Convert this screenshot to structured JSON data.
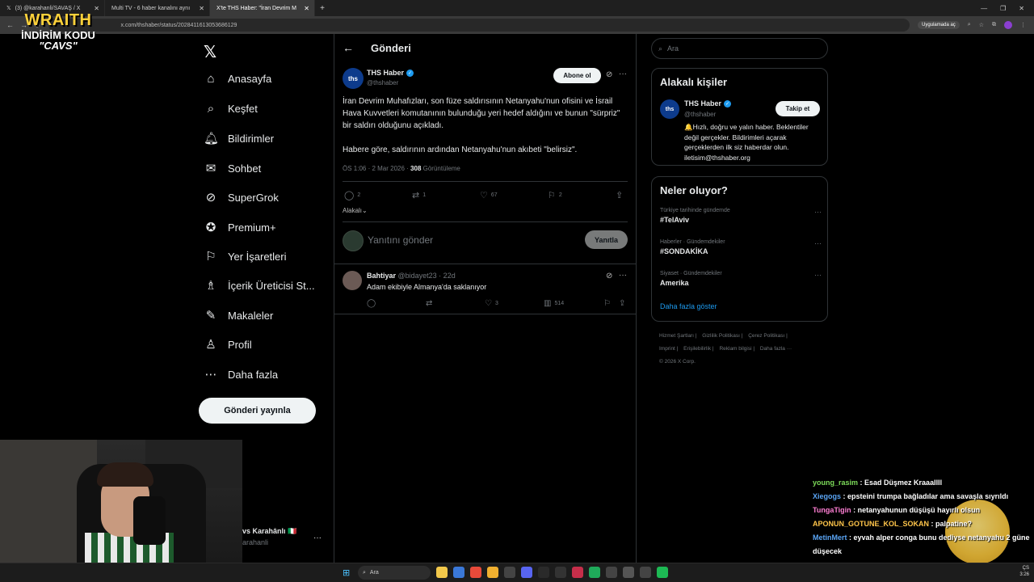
{
  "browser": {
    "tabs": [
      {
        "label": "(3) @karahanli/SAVAŞ / X",
        "active": false
      },
      {
        "label": "Multi TV - 6 haber kanalını aynı",
        "active": false
      },
      {
        "label": "X'te THS Haber: \"İran Devrim M",
        "active": true
      }
    ],
    "url": "x.com/thshaber/status/2028411613053686129",
    "app_chip": "Uygulamada aç"
  },
  "overlay": {
    "brand": "WRAITH",
    "promo_label": "İNDİRİM KODU",
    "promo_code": "\"CAVS\""
  },
  "nav": {
    "logo": "𝕏",
    "items": [
      {
        "label": "Anasayfa",
        "icon": "home-icon",
        "glyph": "⌂"
      },
      {
        "label": "Keşfet",
        "icon": "search-icon",
        "glyph": "⌕"
      },
      {
        "label": "Bildirimler",
        "icon": "bell-icon",
        "glyph": "🔔︎"
      },
      {
        "label": "Sohbet",
        "icon": "mail-icon",
        "glyph": "✉"
      },
      {
        "label": "SuperGrok",
        "icon": "grok-icon",
        "glyph": "⊘"
      },
      {
        "label": "Premium+",
        "icon": "premium-icon",
        "glyph": "✪"
      },
      {
        "label": "Yer İşaretleri",
        "icon": "bookmark-icon",
        "glyph": "⚐"
      },
      {
        "label": "İçerik Üreticisi St...",
        "icon": "creator-icon",
        "glyph": "♗"
      },
      {
        "label": "Makaleler",
        "icon": "article-icon",
        "glyph": "✎"
      },
      {
        "label": "Profil",
        "icon": "profile-icon",
        "glyph": "♙"
      },
      {
        "label": "Daha fazla",
        "icon": "more-circle-icon",
        "glyph": "⋯"
      }
    ],
    "post_button": "Gönderi yayınla"
  },
  "main": {
    "title": "Gönderi",
    "tweet": {
      "avatar_text": "ths",
      "name": "THS Haber",
      "handle": "@thshaber",
      "subscribe": "Abone ol",
      "paragraph1": "İran Devrim Muhafızları, son füze saldırısının Netanyahu'nun ofisini ve İsrail Hava Kuvvetleri komutanının bulunduğu yeri hedef aldığını ve bunun \"sürpriz\" bir saldırı olduğunu açıkladı.",
      "paragraph2": "Habere göre, saldırının ardından Netanyahu'nun akıbeti \"belirsiz\".",
      "time": "ÖS 1:06 · 2 Mar 2026 · ",
      "views": "308",
      "views_label": " Görüntüleme",
      "replies": "2",
      "reposts": "1",
      "likes": "67",
      "bookmarks": "2"
    },
    "relevant": "Alakalı",
    "reply_placeholder": "Yanıtını gönder",
    "reply_button": "Yanıtla",
    "comment": {
      "name": "Bahtiyar",
      "meta": " @bidayet23 · 22d",
      "text": "Adam ekibiyle Almanya'da saklanıyor",
      "likes": "3",
      "views": "514"
    }
  },
  "right": {
    "search_placeholder": "Ara",
    "related_title": "Alakalı kişiler",
    "related": {
      "avatar_text": "ths",
      "name": "THS Haber",
      "handle": "@thshaber",
      "follow": "Takip et",
      "bio": "🔔Hızlı, doğru ve yalın haber. Beklentiler değil gerçekler. Bildirimleri açarak gerçeklerden ilk siz haberdar olun. iletisim@thshaber.org"
    },
    "trends_title": "Neler oluyor?",
    "trends": [
      {
        "category": "Türkiye tarihinde gündemde",
        "tag": "#TelAviv"
      },
      {
        "category": "Haberler · Gündemdekiler",
        "tag": "#SONDAKİKA"
      },
      {
        "category": "Siyaset · Gündemdekiler",
        "tag": "Amerika"
      }
    ],
    "show_more": "Daha fazla göster",
    "footer": [
      "Hizmet Şartları |",
      "Gizlilik Politikası |",
      "Çerez Politikası |",
      "Imprint |",
      "Erişilebilirlik |",
      "Reklam bilgisi |",
      "Daha fazla ···",
      "© 2026 X Corp."
    ]
  },
  "profile_strip": {
    "name": "vs Karahânlı 🇮🇹",
    "handle": "arahanli"
  },
  "chat": [
    {
      "user": "young_rasim",
      "msg": " : Esad Düşmez Kraaallll"
    },
    {
      "user": "Xiegogs",
      "msg": " : epsteini trumpa bağladılar ama savaşla sıyrıldı"
    },
    {
      "user": "TungaTigin",
      "msg": " : netanyahunun düşüşü hayırlı olsun"
    },
    {
      "user": "APONUN_GOTUNE_KOL_SOKAN",
      "msg": " : palpatine?"
    },
    {
      "user": "MetinMert",
      "msg": " : eyvah alper conga bunu dediyse netanyahu 2 güne düşecek"
    }
  ],
  "taskbar": {
    "search": "Ara",
    "clock_line1": "ÇS",
    "clock_line2": "3:26"
  },
  "colors": {
    "accent": "#1d9bf0",
    "background": "#000000",
    "brand_yellow": "#ffd23a"
  }
}
